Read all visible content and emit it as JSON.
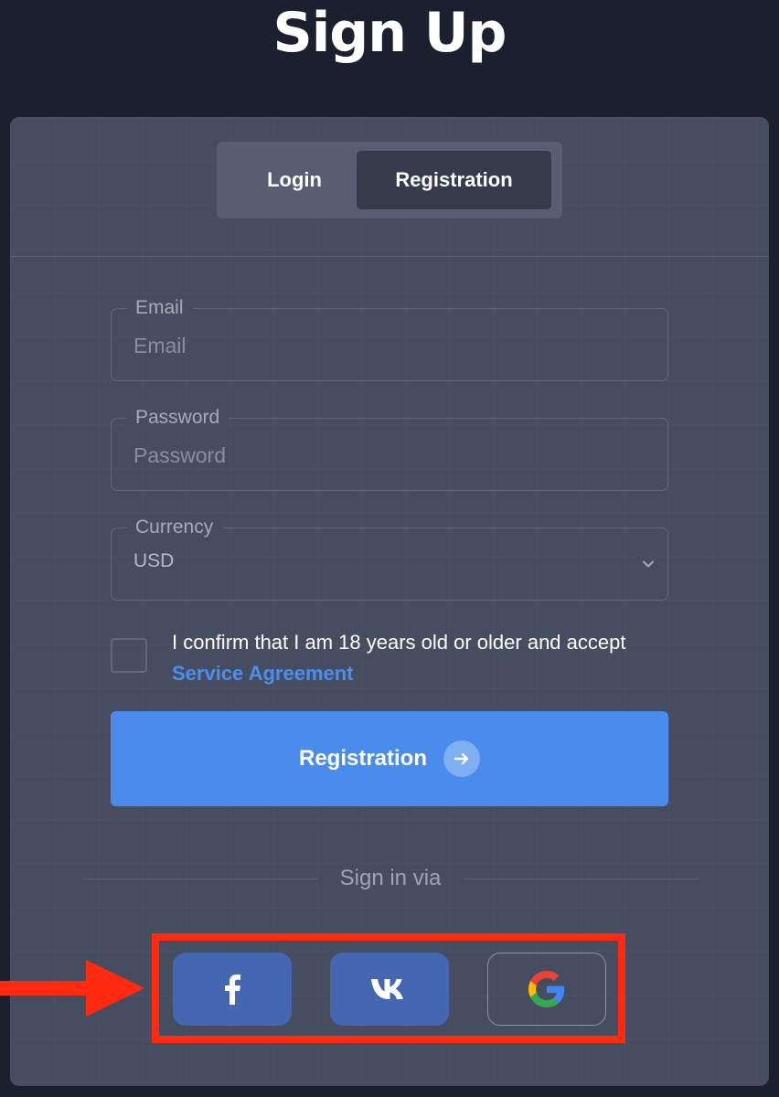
{
  "page": {
    "title": "Sign Up"
  },
  "tabs": [
    {
      "label": "Login",
      "active": false
    },
    {
      "label": "Registration",
      "active": true
    }
  ],
  "form": {
    "email": {
      "legend": "Email",
      "placeholder": "Email"
    },
    "password": {
      "legend": "Password",
      "placeholder": "Password"
    },
    "currency": {
      "legend": "Currency",
      "value": "USD"
    },
    "confirm_text": "I confirm that I am 18 years old or older and accept",
    "agreement_link": "Service Agreement",
    "submit_label": "Registration"
  },
  "social": {
    "label": "Sign in via",
    "buttons": [
      {
        "name": "facebook",
        "icon": "facebook-icon"
      },
      {
        "name": "vk",
        "icon": "vk-icon"
      },
      {
        "name": "google",
        "icon": "google-icon"
      }
    ]
  },
  "colors": {
    "background": "#1c1f2e",
    "card": "#474d60",
    "primary_button": "#4a8cec",
    "link": "#4a8ff0",
    "social_button": "#4566b0",
    "highlight": "#ff2a10"
  }
}
